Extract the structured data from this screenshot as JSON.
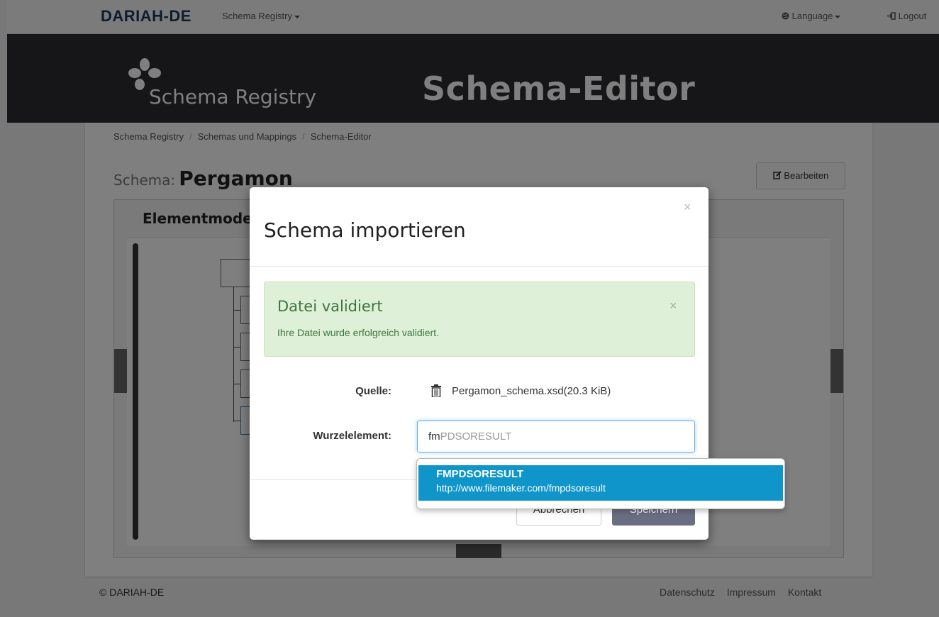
{
  "topnav": {
    "brand": "DARIAH-DE",
    "menu_label": "Schema Registry",
    "language_label": "Language",
    "logout_label": "Logout"
  },
  "banner": {
    "logo_text": "Schema Registry",
    "title": "Schema-Editor"
  },
  "breadcrumb": [
    "Schema Registry",
    "Schemas und Mappings",
    "Schema-Editor"
  ],
  "schema": {
    "label": "Schema:",
    "name": "Pergamon",
    "edit_button": "Bearbeiten"
  },
  "model_panel": {
    "title": "Elementmodell"
  },
  "footer": {
    "copyright": "© DARIAH-DE",
    "links": [
      "Datenschutz",
      "Impressum",
      "Kontakt"
    ]
  },
  "modal": {
    "title": "Schema importieren",
    "close_symbol": "×",
    "alert": {
      "title": "Datei validiert",
      "text": "Ihre Datei wurde erfolgreich validiert.",
      "close_symbol": "×"
    },
    "source_label": "Quelle:",
    "source_file": "Pergamon_schema.xsd(20.3 KiB)",
    "root_label": "Wurzelelement:",
    "root_typed": "fm",
    "root_hint": "PDSORESULT",
    "cancel_button": "Abbrechen",
    "save_button": "Speichern"
  },
  "autocomplete": {
    "items": [
      {
        "title": "FMPDSORESULT",
        "namespace": "http://www.filemaker.com/fmpdsoresult"
      }
    ]
  },
  "colors": {
    "brand": "#1b3a5c",
    "banner_bg": "#2d2d33",
    "alert_bg": "#dff0d8",
    "alert_text": "#3c763d",
    "ac_highlight": "#0f95c9",
    "save_button": "#6a6e82"
  }
}
